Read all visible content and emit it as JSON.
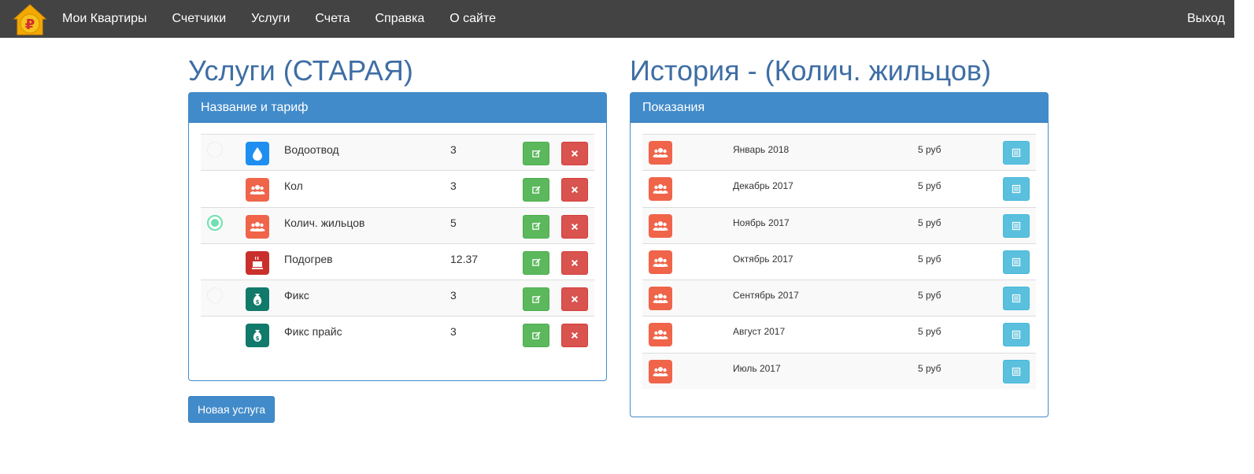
{
  "nav": {
    "logo": "ruble-house-logo",
    "links": [
      "Мои Квартиры",
      "Счетчики",
      "Услуги",
      "Счета",
      "Справка",
      "О сайте"
    ],
    "exit": "Выход"
  },
  "services": {
    "heading": "Услуги (СТАРАЯ)",
    "panel_title": "Название и тариф",
    "rows": [
      {
        "name": "Водоотвод",
        "value": "3",
        "icon": "water-drop-icon",
        "icon_color": "#1e8ff0",
        "radio": "off"
      },
      {
        "name": "Кол",
        "value": "3",
        "icon": "people-icon",
        "icon_color": "#f0644a",
        "radio": "none"
      },
      {
        "name": "Колич. жильцов",
        "value": "5",
        "icon": "people-icon",
        "icon_color": "#f0644a",
        "radio": "on"
      },
      {
        "name": "Подогрев",
        "value": "12.37",
        "icon": "heater-icon",
        "icon_color": "#c9302c",
        "radio": "none"
      },
      {
        "name": "Фикс",
        "value": "3",
        "icon": "money-bag-icon",
        "icon_color": "#117a6b",
        "radio": "off"
      },
      {
        "name": "Фикс прайс",
        "value": "3",
        "icon": "money-bag-icon",
        "icon_color": "#117a6b",
        "radio": "none"
      }
    ],
    "new_button": "Новая услуга"
  },
  "history": {
    "heading": "История - (Колич. жильцов)",
    "panel_title": "Показания",
    "rows": [
      {
        "date": "Январь 2018",
        "price": "5 руб"
      },
      {
        "date": "Декабрь 2017",
        "price": "5 руб"
      },
      {
        "date": "Ноябрь 2017",
        "price": "5 руб"
      },
      {
        "date": "Октябрь 2017",
        "price": "5 руб"
      },
      {
        "date": "Сентябрь 2017",
        "price": "5 руб"
      },
      {
        "date": "Август 2017",
        "price": "5 руб"
      },
      {
        "date": "Июль 2017",
        "price": "5 руб"
      }
    ]
  },
  "colors": {
    "navbar": "#434343",
    "primary": "#428bca",
    "heading": "#3f6ea5",
    "success": "#5cb85c",
    "danger": "#d9534f",
    "info": "#5bc0de"
  }
}
